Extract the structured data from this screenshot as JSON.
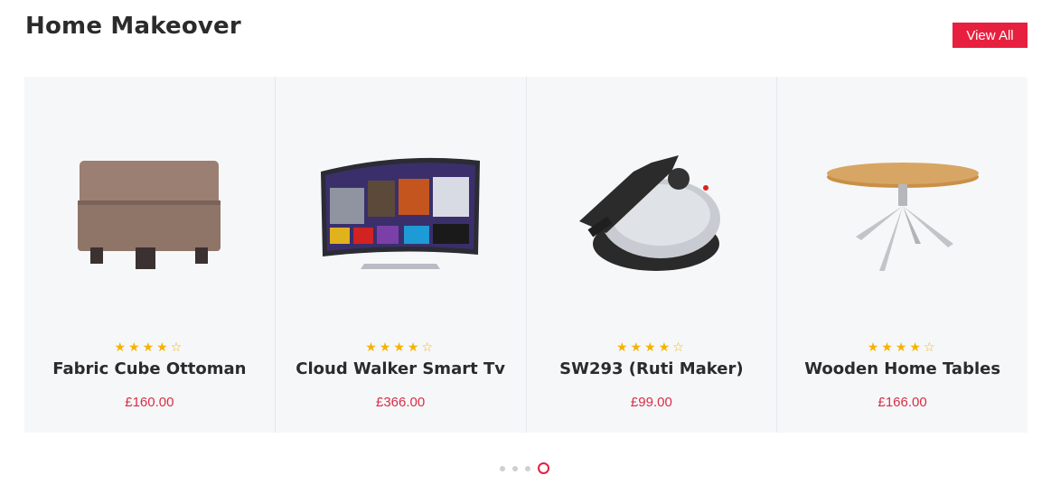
{
  "section": {
    "title": "Home Makeover",
    "view_all_label": "View All"
  },
  "products": [
    {
      "name": "Fabric Cube Ottoman",
      "price": "£160.00",
      "rating": 4,
      "max_rating": 5,
      "image": "ottoman"
    },
    {
      "name": "Cloud Walker Smart Tv",
      "price": "£366.00",
      "rating": 4,
      "max_rating": 5,
      "image": "smart-tv"
    },
    {
      "name": "SW293 (Ruti Maker)",
      "price": "£99.00",
      "rating": 4,
      "max_rating": 5,
      "image": "roti-maker"
    },
    {
      "name": "Wooden Home Tables",
      "price": "£166.00",
      "rating": 4,
      "max_rating": 5,
      "image": "round-table"
    }
  ],
  "carousel": {
    "pages": 4,
    "active_page": 4
  },
  "colors": {
    "accent": "#e8203f",
    "price": "#d72f46",
    "star": "#f5b301",
    "card_bg": "#f6f7f9"
  }
}
